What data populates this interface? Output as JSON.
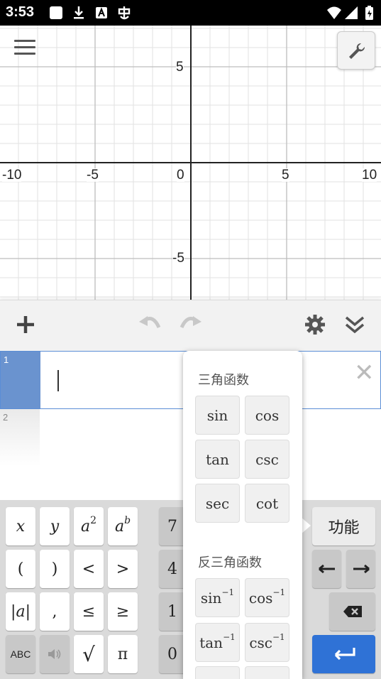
{
  "status_bar": {
    "time": "3:53"
  },
  "graph": {
    "x_ticks": [
      "-10",
      "-5",
      "0",
      "5",
      "10"
    ],
    "y_ticks": [
      "5",
      "-5"
    ]
  },
  "expressions": [
    {
      "number": "1",
      "value": ""
    },
    {
      "number": "2",
      "value": ""
    }
  ],
  "keypad": {
    "left": [
      [
        "x",
        "y",
        "a²",
        "aᵇ"
      ],
      [
        "(",
        ")",
        "<",
        ">"
      ],
      [
        "|a|",
        ",",
        "≤",
        "≥"
      ],
      [
        "ABC",
        "speaker",
        "√",
        "π"
      ]
    ],
    "numbers": [
      "7",
      "4",
      "1",
      "0"
    ],
    "functions_label": "功能"
  },
  "popup": {
    "trig_header": "三角函数",
    "trig": [
      "sin",
      "cos",
      "tan",
      "csc",
      "sec",
      "cot"
    ],
    "inverse_header": "反三角函数",
    "inverse": [
      {
        "base": "sin",
        "exp": "−1"
      },
      {
        "base": "cos",
        "exp": "−1"
      },
      {
        "base": "tan",
        "exp": "−1"
      },
      {
        "base": "csc",
        "exp": "−1"
      }
    ]
  },
  "colors": {
    "accent": "#2f72d6",
    "selected_gutter": "#6a93cf",
    "axis": "#222222",
    "grid": "#cccccc"
  }
}
